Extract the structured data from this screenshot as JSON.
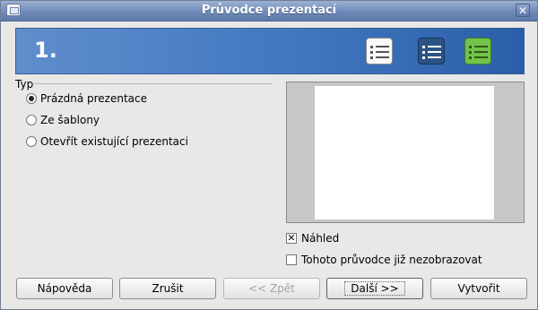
{
  "window": {
    "title": "Průvodce prezentací"
  },
  "banner": {
    "step": "1."
  },
  "type_group": {
    "label": "Typ",
    "options": [
      {
        "label": "Prázdná prezentace",
        "selected": true
      },
      {
        "label": "Ze šablony",
        "selected": false
      },
      {
        "label": "Otevřít existující prezentaci",
        "selected": false
      }
    ]
  },
  "preview_checkbox": {
    "label": "Náhled",
    "checked": true
  },
  "dont_show_checkbox": {
    "label": "Tohoto průvodce již nezobrazovat",
    "checked": false
  },
  "buttons": {
    "help": "Nápověda",
    "cancel": "Zrušit",
    "back": "<< Zpět",
    "next": "Další >>",
    "create": "Vytvořit"
  },
  "icons": [
    "window-app-icon",
    "close-icon",
    "outline-view-icon",
    "notes-view-icon",
    "green-notes-icon"
  ]
}
